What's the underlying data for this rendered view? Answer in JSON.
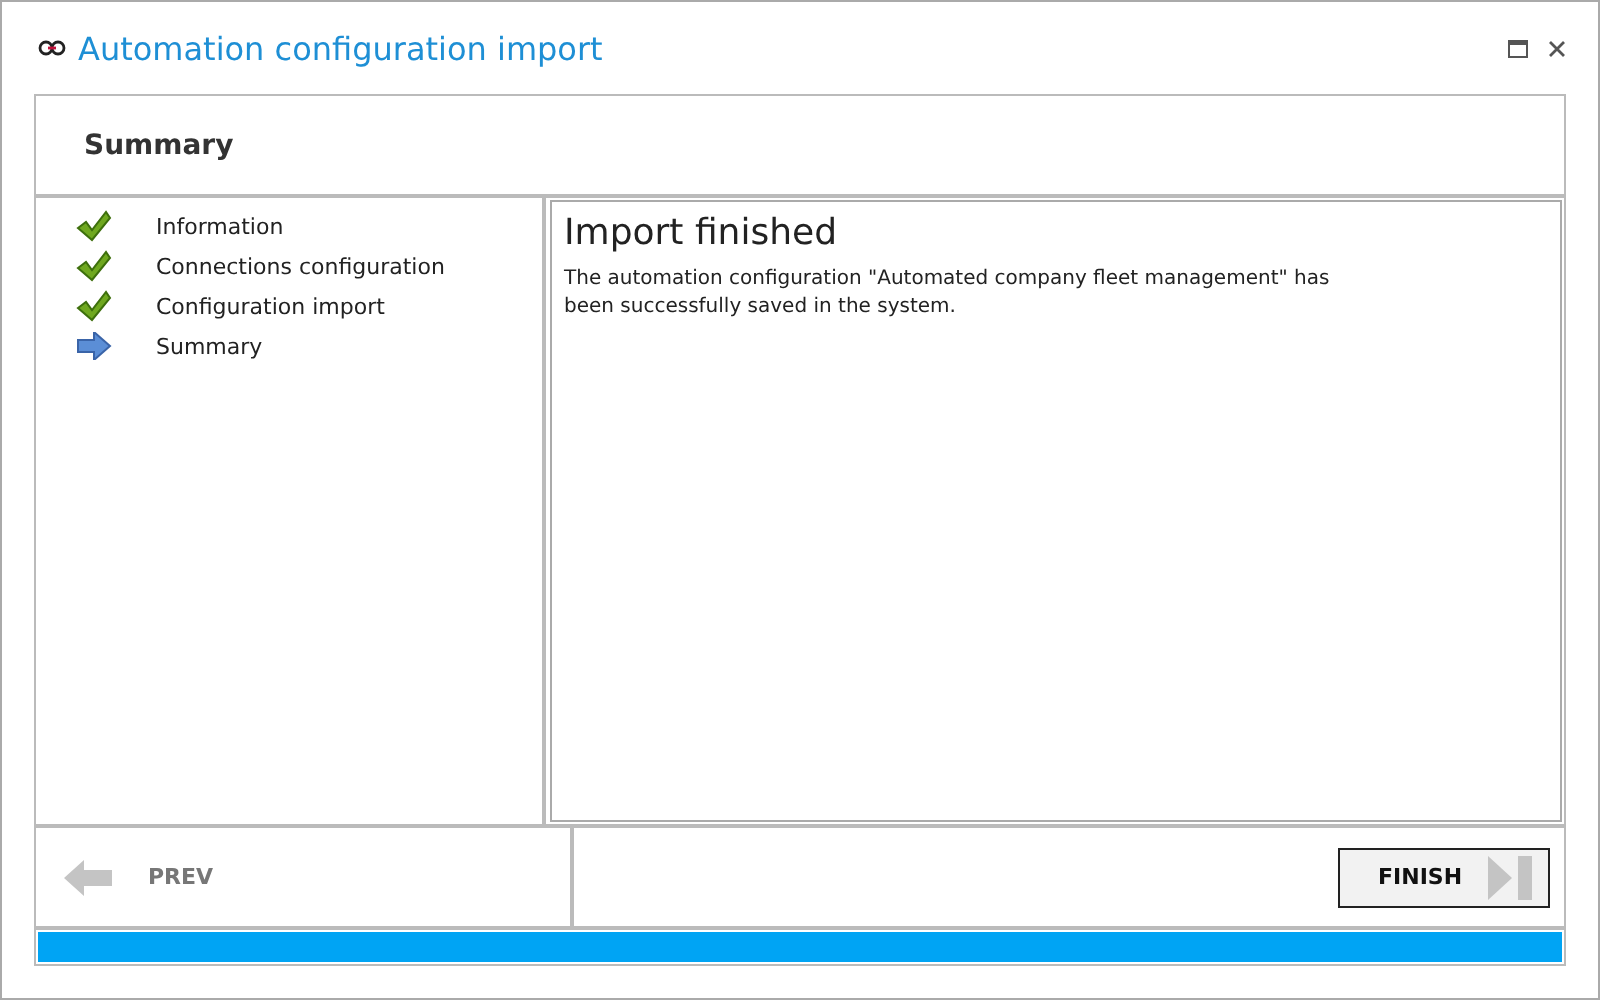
{
  "window": {
    "title": "Automation configuration import"
  },
  "header": {
    "title": "Summary"
  },
  "steps": [
    {
      "label": "Information",
      "kind": "done"
    },
    {
      "label": "Connections configuration",
      "kind": "done"
    },
    {
      "label": "Configuration import",
      "kind": "done"
    },
    {
      "label": "Summary",
      "kind": "current"
    }
  ],
  "content": {
    "heading": "Import finished",
    "message": "The automation configuration \"Automated company fleet management\" has been successfully saved in the system."
  },
  "buttons": {
    "prev": {
      "label": "PREV",
      "disabled": true
    },
    "finish": {
      "label": "FINISH",
      "disabled": false
    }
  },
  "progress": {
    "level": 1
  }
}
